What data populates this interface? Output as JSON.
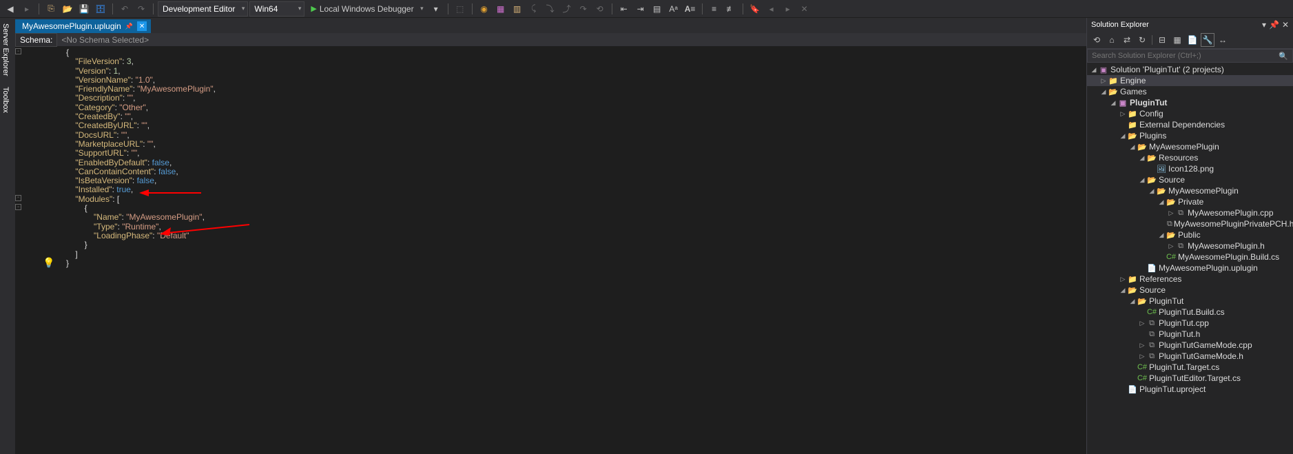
{
  "toolbar": {
    "config_dd": "Development Editor",
    "platform_dd": "Win64",
    "debug_label": "Local Windows Debugger"
  },
  "side_tabs": [
    "Server Explorer",
    "Toolbox"
  ],
  "file_tab": {
    "name": "MyAwesomePlugin.uplugin"
  },
  "schema": {
    "label": "Schema:",
    "value": "<No Schema Selected>"
  },
  "code": {
    "lines": [
      {
        "indent": 0,
        "raw": "{"
      },
      {
        "indent": 1,
        "key": "\"FileVersion\"",
        "sep": ": ",
        "val": "3",
        "vtype": "num",
        "tail": ","
      },
      {
        "indent": 1,
        "key": "\"Version\"",
        "sep": ": ",
        "val": "1",
        "vtype": "num",
        "tail": ","
      },
      {
        "indent": 1,
        "key": "\"VersionName\"",
        "sep": ": ",
        "val": "\"1.0\"",
        "vtype": "str",
        "tail": ","
      },
      {
        "indent": 1,
        "key": "\"FriendlyName\"",
        "sep": ": ",
        "val": "\"MyAwesomePlugin\"",
        "vtype": "str",
        "tail": ","
      },
      {
        "indent": 1,
        "key": "\"Description\"",
        "sep": ": ",
        "val": "\"\"",
        "vtype": "str",
        "tail": ","
      },
      {
        "indent": 1,
        "key": "\"Category\"",
        "sep": ": ",
        "val": "\"Other\"",
        "vtype": "str",
        "tail": ","
      },
      {
        "indent": 1,
        "key": "\"CreatedBy\"",
        "sep": ": ",
        "val": "\"\"",
        "vtype": "str",
        "tail": ","
      },
      {
        "indent": 1,
        "key": "\"CreatedByURL\"",
        "sep": ": ",
        "val": "\"\"",
        "vtype": "str",
        "tail": ","
      },
      {
        "indent": 1,
        "key": "\"DocsURL\"",
        "sep": ": ",
        "val": "\"\"",
        "vtype": "str",
        "tail": ","
      },
      {
        "indent": 1,
        "key": "\"MarketplaceURL\"",
        "sep": ": ",
        "val": "\"\"",
        "vtype": "str",
        "tail": ","
      },
      {
        "indent": 1,
        "key": "\"SupportURL\"",
        "sep": ": ",
        "val": "\"\"",
        "vtype": "str",
        "tail": ","
      },
      {
        "indent": 1,
        "key": "\"EnabledByDefault\"",
        "sep": ": ",
        "val": "false",
        "vtype": "kw",
        "tail": ","
      },
      {
        "indent": 1,
        "key": "\"CanContainContent\"",
        "sep": ": ",
        "val": "false",
        "vtype": "kw",
        "tail": ","
      },
      {
        "indent": 1,
        "key": "\"IsBetaVersion\"",
        "sep": ": ",
        "val": "false",
        "vtype": "kw",
        "tail": ","
      },
      {
        "indent": 1,
        "key": "\"Installed\"",
        "sep": ": ",
        "val": "true",
        "vtype": "kw",
        "tail": ","
      },
      {
        "indent": 1,
        "key": "\"Modules\"",
        "sep": ": [",
        "val": "",
        "vtype": "none",
        "tail": ""
      },
      {
        "indent": 2,
        "raw": "{"
      },
      {
        "indent": 3,
        "key": "\"Name\"",
        "sep": ": ",
        "val": "\"MyAwesomePlugin\"",
        "vtype": "str",
        "tail": ","
      },
      {
        "indent": 3,
        "key": "\"Type\"",
        "sep": ": ",
        "val": "\"Runtime\"",
        "vtype": "str",
        "tail": ","
      },
      {
        "indent": 3,
        "key": "\"LoadingPhase\"",
        "sep": ": ",
        "val": "\"Default\"",
        "vtype": "str",
        "tail": ""
      },
      {
        "indent": 2,
        "raw": "}"
      },
      {
        "indent": 1,
        "raw": "]"
      },
      {
        "indent": 0,
        "raw": "}"
      }
    ]
  },
  "solution_explorer": {
    "title": "Solution Explorer",
    "search_placeholder": "Search Solution Explorer (Ctrl+;)",
    "solution": "Solution 'PluginTut' (2 projects)",
    "tree": [
      {
        "d": 1,
        "tw": "▷",
        "icon": "folder",
        "label": "Engine",
        "cls": "engine-row"
      },
      {
        "d": 1,
        "tw": "◢",
        "icon": "folder-open",
        "label": "Games"
      },
      {
        "d": 2,
        "tw": "◢",
        "icon": "proj",
        "label": "PluginTut",
        "bold": true
      },
      {
        "d": 3,
        "tw": "▷",
        "icon": "folder",
        "label": "Config"
      },
      {
        "d": 3,
        "tw": "",
        "icon": "folder",
        "label": "External Dependencies"
      },
      {
        "d": 3,
        "tw": "◢",
        "icon": "folder-open",
        "label": "Plugins"
      },
      {
        "d": 4,
        "tw": "◢",
        "icon": "folder-open",
        "label": "MyAwesomePlugin"
      },
      {
        "d": 5,
        "tw": "◢",
        "icon": "folder-open",
        "label": "Resources"
      },
      {
        "d": 6,
        "tw": "",
        "icon": "img",
        "label": "Icon128.png"
      },
      {
        "d": 5,
        "tw": "◢",
        "icon": "folder-open",
        "label": "Source"
      },
      {
        "d": 6,
        "tw": "◢",
        "icon": "folder-open",
        "label": "MyAwesomePlugin"
      },
      {
        "d": 7,
        "tw": "◢",
        "icon": "folder-open",
        "label": "Private"
      },
      {
        "d": 8,
        "tw": "▷",
        "icon": "cpp",
        "label": "MyAwesomePlugin.cpp"
      },
      {
        "d": 8,
        "tw": "",
        "icon": "hfile",
        "label": "MyAwesomePluginPrivatePCH.h"
      },
      {
        "d": 7,
        "tw": "◢",
        "icon": "folder-open",
        "label": "Public"
      },
      {
        "d": 8,
        "tw": "▷",
        "icon": "hfile",
        "label": "MyAwesomePlugin.h"
      },
      {
        "d": 7,
        "tw": "",
        "icon": "cs",
        "label": "MyAwesomePlugin.Build.cs"
      },
      {
        "d": 5,
        "tw": "",
        "icon": "txt",
        "label": "MyAwesomePlugin.uplugin"
      },
      {
        "d": 3,
        "tw": "▷",
        "icon": "folder",
        "label": "References"
      },
      {
        "d": 3,
        "tw": "◢",
        "icon": "folder-open",
        "label": "Source"
      },
      {
        "d": 4,
        "tw": "◢",
        "icon": "folder-open",
        "label": "PluginTut"
      },
      {
        "d": 5,
        "tw": "",
        "icon": "cs",
        "label": "PluginTut.Build.cs"
      },
      {
        "d": 5,
        "tw": "▷",
        "icon": "cpp",
        "label": "PluginTut.cpp"
      },
      {
        "d": 5,
        "tw": "",
        "icon": "hfile",
        "label": "PluginTut.h"
      },
      {
        "d": 5,
        "tw": "▷",
        "icon": "cpp",
        "label": "PluginTutGameMode.cpp"
      },
      {
        "d": 5,
        "tw": "▷",
        "icon": "hfile",
        "label": "PluginTutGameMode.h"
      },
      {
        "d": 4,
        "tw": "",
        "icon": "cs",
        "label": "PluginTut.Target.cs"
      },
      {
        "d": 4,
        "tw": "",
        "icon": "cs",
        "label": "PluginTutEditor.Target.cs"
      },
      {
        "d": 3,
        "tw": "",
        "icon": "txt",
        "label": "PluginTut.uproject"
      }
    ]
  }
}
